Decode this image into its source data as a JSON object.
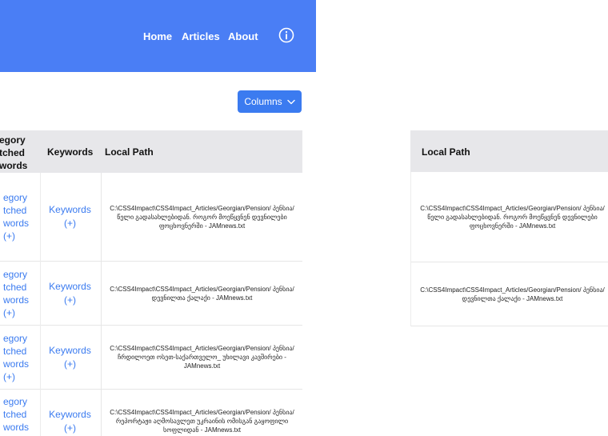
{
  "nav": {
    "home": "Home",
    "articles": "Articles",
    "about": "About",
    "info_icon": "info-circle-icon"
  },
  "toolbar": {
    "columns_label": "Columns",
    "columns_icon": "chevron-down-icon"
  },
  "table": {
    "headers": {
      "category_matched_keywords": [
        "egory",
        "tched",
        "words"
      ],
      "keywords": "Keywords",
      "local_path": "Local Path"
    },
    "rows": [
      {
        "category": [
          "egory",
          "tched",
          "words",
          "(+)"
        ],
        "keywords": [
          "Keywords",
          "(+)"
        ],
        "path": "C:\\CSS4Impact\\CSS4Impact_Articles/Georgian/Pension/ პენსია/ წელი გადასახლებიდან. როგორ მოეწყვნენ დევნილები ფოცხოვნერში - JAMnews.txt"
      },
      {
        "category": [
          "egory",
          "tched",
          "words",
          "(+)"
        ],
        "keywords": [
          "Keywords",
          "(+)"
        ],
        "path": "C:\\CSS4Impact\\CSS4Impact_Articles/Georgian/Pension/ პენსია/დევნილთა ქალაქი - JAMnews.txt"
      },
      {
        "category": [
          "egory",
          "tched",
          "words",
          "(+)"
        ],
        "keywords": [
          "Keywords",
          "(+)"
        ],
        "path": "C:\\CSS4Impact\\CSS4Impact_Articles/Georgian/Pension/ პენსია/ჩრდილოეთ ოსეთ-საქართველო_ უხილავი კავშირები - JAMnews.txt"
      },
      {
        "category": [
          "egory",
          "tched",
          "words"
        ],
        "keywords": [
          "Keywords",
          "(+)"
        ],
        "path": "C:\\CSS4Impact\\CSS4Impact_Articles/Georgian/Pension/ პენსია/რეპორტაჟი აღმოსავლეთ უკრაინის ომისგან გაყოფილი სოფლიდან - JAMnews.txt"
      }
    ]
  },
  "right_table": {
    "header": "Local Path",
    "rows": [
      "C:\\CSS4Impact\\CSS4Impact_Articles/Georgian/Pension/ პენსია/ წელი გადასახლებიდან. როგორ მოეწყვნენ დევნილები ფოცხოვნერში - JAMnews.txt",
      "C:\\CSS4Impact\\CSS4Impact_Articles/Georgian/Pension/ პენსია/დევნილთა ქალაქი - JAMnews.txt"
    ]
  },
  "colors": {
    "navbar": "#4a7ef5",
    "accent": "#3b7bf0",
    "header_bg": "#e7e7ea"
  }
}
